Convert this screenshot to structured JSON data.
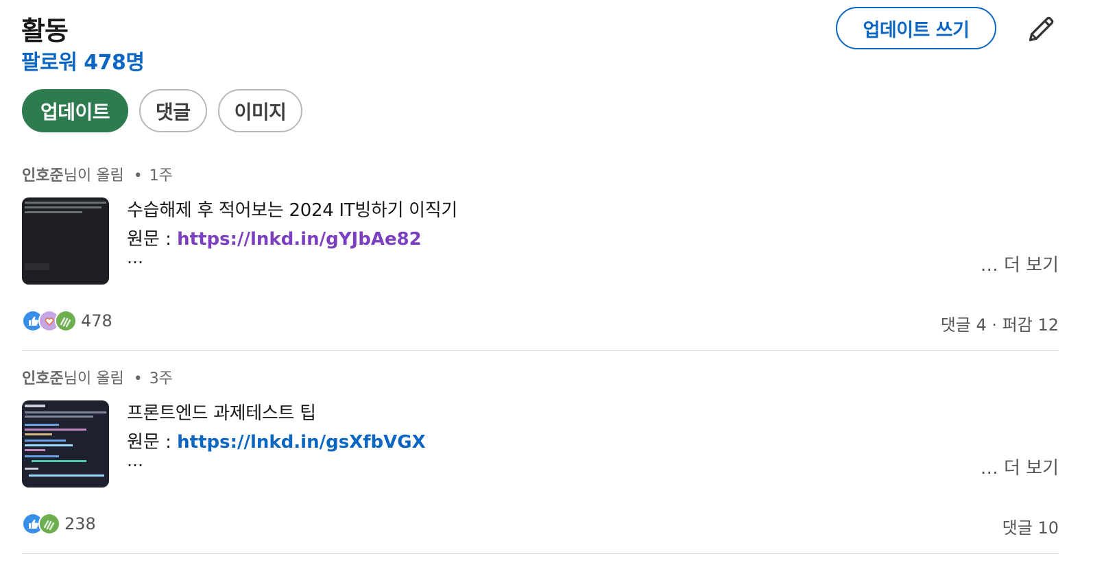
{
  "header": {
    "title": "활동",
    "followers": "팔로워 478명",
    "write_label": "업데이트 쓰기"
  },
  "filters": [
    {
      "label": "업데이트",
      "active": true
    },
    {
      "label": "댓글",
      "active": false
    },
    {
      "label": "이미지",
      "active": false
    }
  ],
  "posts": [
    {
      "author": "인호준",
      "action": "님이 올림",
      "time": "1주",
      "title": "수습해제 후 적어보는 2024 IT빙하기 이직기",
      "source_label": "원문 : ",
      "link": "https://lnkd.in/gYJbAe82",
      "link_color": "#7b3fbf",
      "ellipsis": "…",
      "more": "… 더 보기",
      "reaction_count": "478",
      "stats": "댓글 4 · 퍼감 12"
    },
    {
      "author": "인호준",
      "action": "님이 올림",
      "time": "3주",
      "title": "프론트엔드 과제테스트 팁",
      "source_label": "원문 : ",
      "link": "https://lnkd.in/gsXfbVGX",
      "link_color": "#0a66c2",
      "ellipsis": "…",
      "more": "… 더 보기",
      "reaction_count": "238",
      "stats": "댓글 10"
    }
  ],
  "icons": {
    "edit": "pencil-icon",
    "reactions": [
      "like-icon",
      "love-icon",
      "celebrate-icon"
    ]
  },
  "colors": {
    "accent": "#0a66c2",
    "active_pill": "#2e7b4f",
    "visited_link": "#7b3fbf"
  }
}
